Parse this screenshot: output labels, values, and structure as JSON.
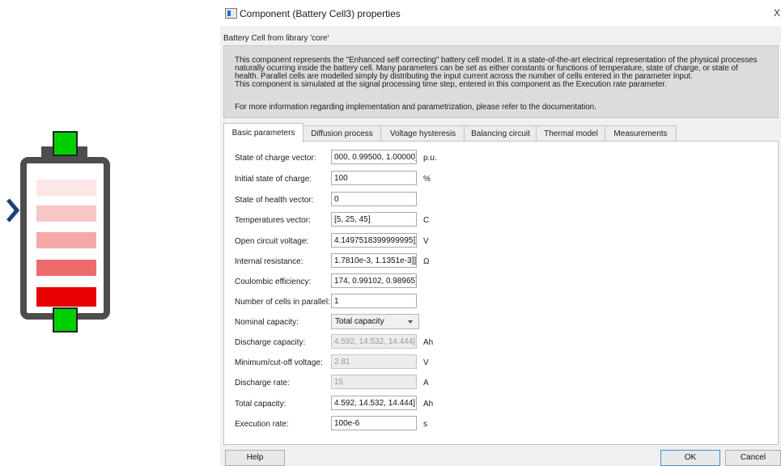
{
  "battery_symbol": {
    "colors": {
      "frame": "#4d4d4d",
      "terminal": "#00d000",
      "cell_levels": [
        "#fde6e6",
        "#f9c6c6",
        "#f5a8a8",
        "#ef6a6a",
        "#e60000"
      ],
      "port_arrow": "#1f3f7a"
    }
  },
  "dialog": {
    "title": "Component (Battery Cell3) properties",
    "close_label": "X",
    "library_label": "Battery Cell from library 'core'",
    "description": [
      "This component represents the \"Enhanced self correcting\" battery cell model. It is a state-of-the-art electrical representation of the physical processes",
      "naturally ocurring inside the battery cell. Many parameters can be set as either constants or functions of temperature, state of charge, or state of",
      "health. Parallel cells are modelled simply by distributing the input current across the number of cells entered in the parameter input.",
      "This component is simulated at the signal processing time step, entered in this component as the Execution rate parameter.",
      "",
      "For more information regarding implementation and parametrization, please refer to the documentation."
    ],
    "tabs": [
      "Basic parameters",
      "Diffusion process",
      "Voltage hysteresis",
      "Balancing circuit",
      "Thermal model",
      "Measurements"
    ],
    "active_tab": "Basic parameters",
    "params": [
      {
        "label": "State of charge vector:",
        "value": "000, 0.99500, 1.00000]",
        "unit": "p.u."
      },
      {
        "label": "Initial state of charge:",
        "value": "100",
        "unit": "%"
      },
      {
        "label": "State of health vector:",
        "value": "0",
        "unit": ""
      },
      {
        "label": "Temperatures vector:",
        "value": "[5, 25, 45]",
        "unit": "C"
      },
      {
        "label": "Open circuit voltage:",
        "value": "4.1497518399999995]]",
        "unit": "V"
      },
      {
        "label": "Internal resistance:",
        "value": "1.7810e-3, 1.1351e-3]]",
        "unit": "Ω"
      },
      {
        "label": "Coulombic efficiency:",
        "value": "174, 0.99102, 0.98965]",
        "unit": ""
      },
      {
        "label": "Number of cells in parallel:",
        "value": "1",
        "unit": ""
      },
      {
        "label": "Nominal capacity:",
        "value": "Total capacity",
        "unit": ""
      },
      {
        "label": "Discharge capacity:",
        "value": "4.592, 14.532, 14.444]",
        "unit": "Ah"
      },
      {
        "label": "Minimum/cut-off voltage:",
        "value": "2.81",
        "unit": "V"
      },
      {
        "label": "Discharge rate:",
        "value": "15",
        "unit": "A"
      },
      {
        "label": "Total capacity:",
        "value": "4.592, 14.532, 14.444]",
        "unit": "Ah"
      },
      {
        "label": "Execution rate:",
        "value": "100e-6",
        "unit": "s"
      }
    ],
    "buttons": {
      "help": "Help",
      "ok": "OK",
      "cancel": "Cancel"
    }
  }
}
